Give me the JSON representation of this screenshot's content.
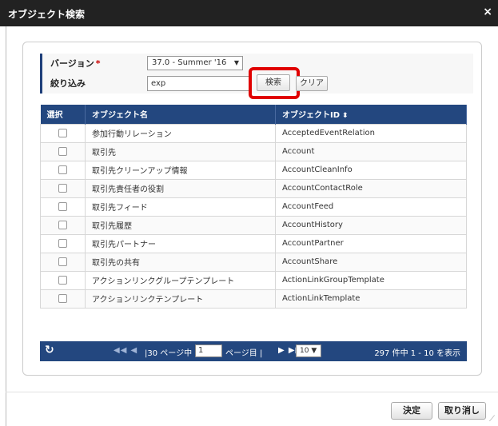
{
  "dialog": {
    "title": "オブジェクト検索",
    "close_label": "×"
  },
  "form": {
    "version_label": "バージョン",
    "required_mark": "*",
    "version_value": "37.0 - Summer '16",
    "filter_label": "絞り込み",
    "filter_value": "exp",
    "search_label": "検索",
    "clear_label": "クリア"
  },
  "table": {
    "headers": [
      "選択",
      "オブジェクト名",
      "オブジェクトID"
    ],
    "rows": [
      {
        "name": "参加行動リレーション",
        "id": "AcceptedEventRelation"
      },
      {
        "name": "取引先",
        "id": "Account"
      },
      {
        "name": "取引先クリーンアップ情報",
        "id": "AccountCleanInfo"
      },
      {
        "name": "取引先責任者の役割",
        "id": "AccountContactRole"
      },
      {
        "name": "取引先フィード",
        "id": "AccountFeed"
      },
      {
        "name": "取引先履歴",
        "id": "AccountHistory"
      },
      {
        "name": "取引先パートナー",
        "id": "AccountPartner"
      },
      {
        "name": "取引先の共有",
        "id": "AccountShare"
      },
      {
        "name": "アクションリンクグループテンプレート",
        "id": "ActionLinkGroupTemplate"
      },
      {
        "name": "アクションリンクテンプレート",
        "id": "ActionLinkTemplate"
      }
    ]
  },
  "pager": {
    "refresh_icon": "refresh-icon",
    "prev_glyphs": "◀◀ ◀",
    "pages_prefix": "|30 ページ中",
    "page_value": "1",
    "pages_suffix": "ページ目 |",
    "next_glyphs": "▶ ▶▶",
    "page_size": "10",
    "summary": "297 件中 1 - 10 を表示"
  },
  "footer": {
    "ok_label": "決定",
    "cancel_label": "取り消し"
  },
  "colors": {
    "header_bg": "#23477f",
    "highlight": "#e00000"
  }
}
